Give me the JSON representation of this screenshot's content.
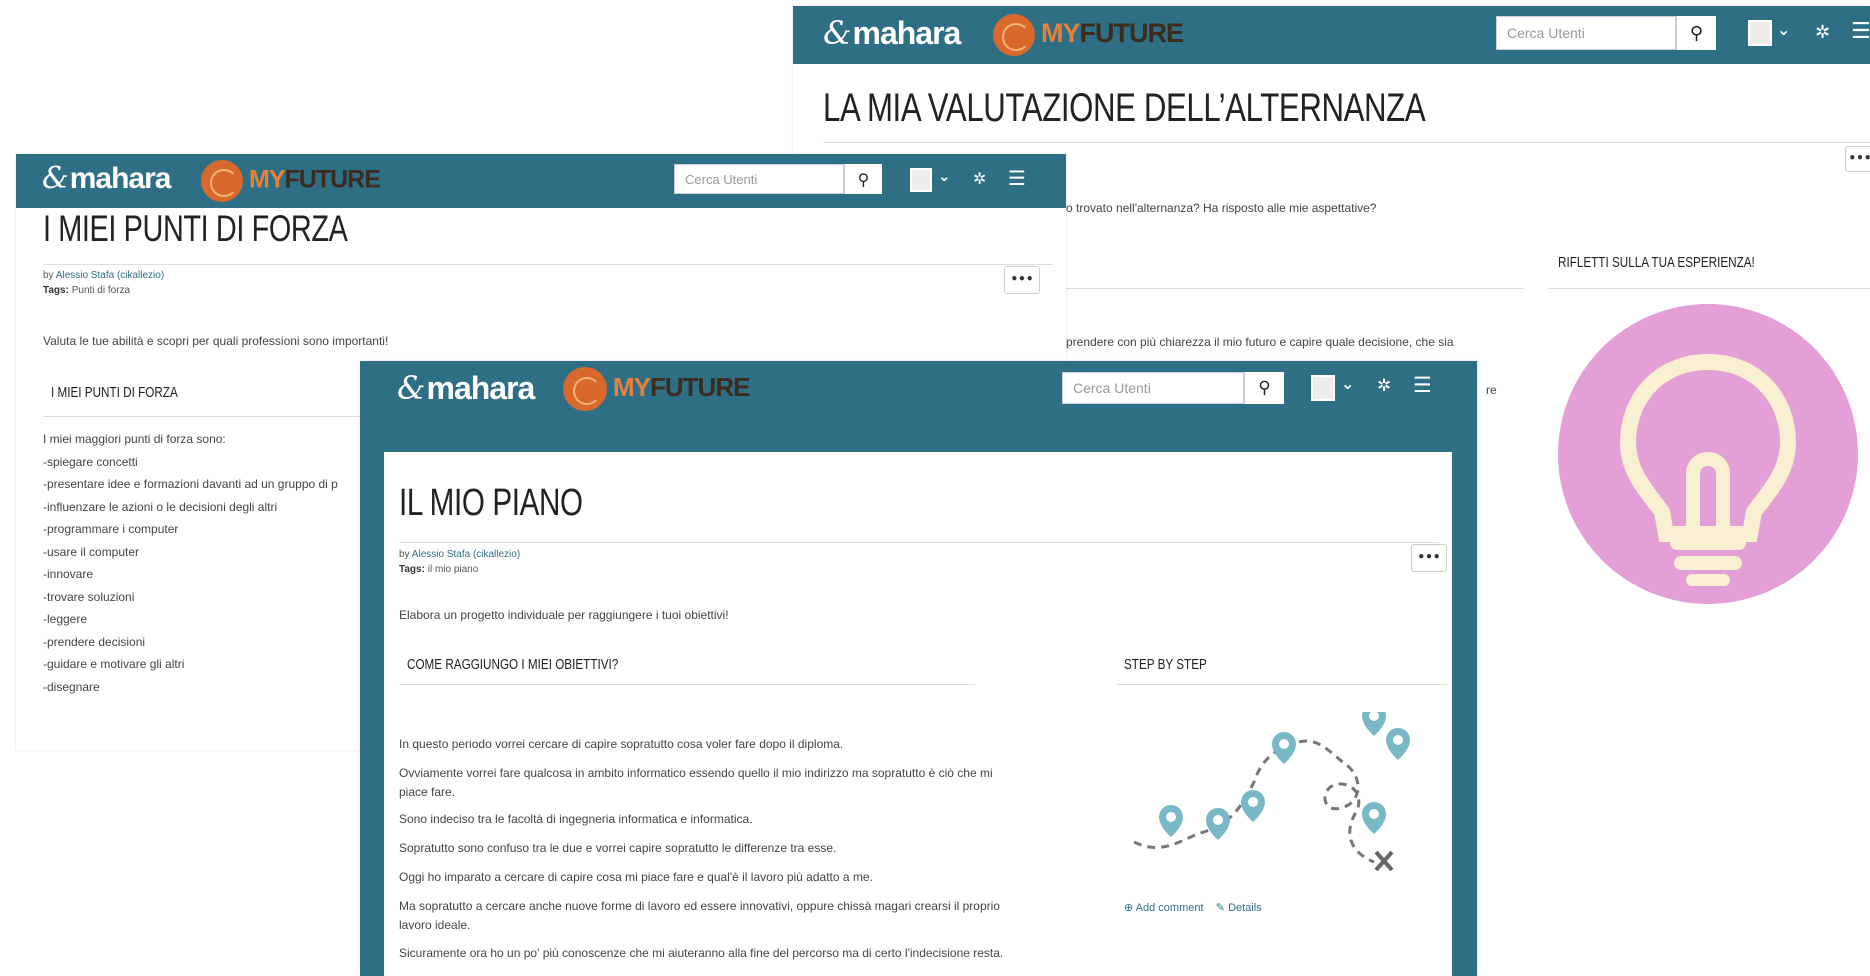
{
  "brand": {
    "mahara": "mahara",
    "my": "MY",
    "future": "FUTURE"
  },
  "search_placeholder": "Cerca Utenti",
  "icons": {
    "search": "search-icon",
    "user": "user-icon",
    "chevron": "chevron-down-icon",
    "wrench": "wrench-icon",
    "menu": "menu-icon",
    "more": "more-icon",
    "comment": "add-comment-icon",
    "details": "details-icon"
  },
  "back_window": {
    "title": "LA MIA VALUTAZIONE DELL’ALTERNANZA",
    "text_1": "o trovato nell'alternanza? Ha risposto alle mie aspettative?",
    "text_2": "prendere con più chiarezza il mio futuro e capire quale decisione, che sia",
    "text_3": "re",
    "side_title": "RIFLETTI SULLA TUA ESPERIENZA!"
  },
  "mid_window": {
    "title": "I MIEI PUNTI DI FORZA",
    "by": "by",
    "author": "Alessio Stafa (cikallezio)",
    "tags_label": "Tags:",
    "tags": "Punti di forza",
    "intro": "Valuta le tue abilità e scopri per quali professioni sono importanti!",
    "section": "I MIEI PUNTI DI FORZA",
    "list": [
      "I miei maggiori punti di forza sono:",
      "-spiegare concetti",
      "-presentare idee e formazioni davanti ad un gruppo di p",
      "-influenzare le azioni o le decisioni degli altri",
      "-programmare i computer",
      "-usare il computer",
      "-innovare",
      "-trovare soluzioni",
      "-leggere",
      "-prendere decisioni",
      "-guidare e motivare gli altri",
      "-disegnare"
    ]
  },
  "front_window": {
    "title": "IL MIO PIANO",
    "by": "by",
    "author": "Alessio Stafa (cikallezio)",
    "tags_label": "Tags:",
    "tags": "il mio piano",
    "intro": "Elabora un progetto individuale per raggiungere i tuoi obiettivi!",
    "section_left": "COME RAGGIUNGO I MIEI OBIETTIVI?",
    "section_right": "STEP BY STEP",
    "paragraphs": [
      "In questo periodo vorrei cercare di capire sopratutto cosa voler fare dopo il diploma.",
      "Ovviamente vorrei fare qualcosa in ambito informatico essendo quello il mio indirizzo ma sopratutto è ciò che mi",
      "piace fare.",
      "Sono indeciso tra le facoltà di ingegneria informatica e informatica.",
      "Sopratutto sono confuso tra le due e vorrei capire sopratutto le differenze tra esse.",
      "Oggi ho imparato a cercare di capire cosa mi piace fare e qual'è il lavoro più adatto a me.",
      "Ma sopratutto a cercare anche nuove forme di lavoro ed essere innovativi, oppure chissà magari crearsi il proprio",
      "lavoro ideale.",
      "Sicuramente ora ho un po' più conoscenze che mi aiuteranno alla fine del percorso ma di certo l'indecisione resta."
    ],
    "add_comment": "Add comment",
    "details": "Details"
  }
}
